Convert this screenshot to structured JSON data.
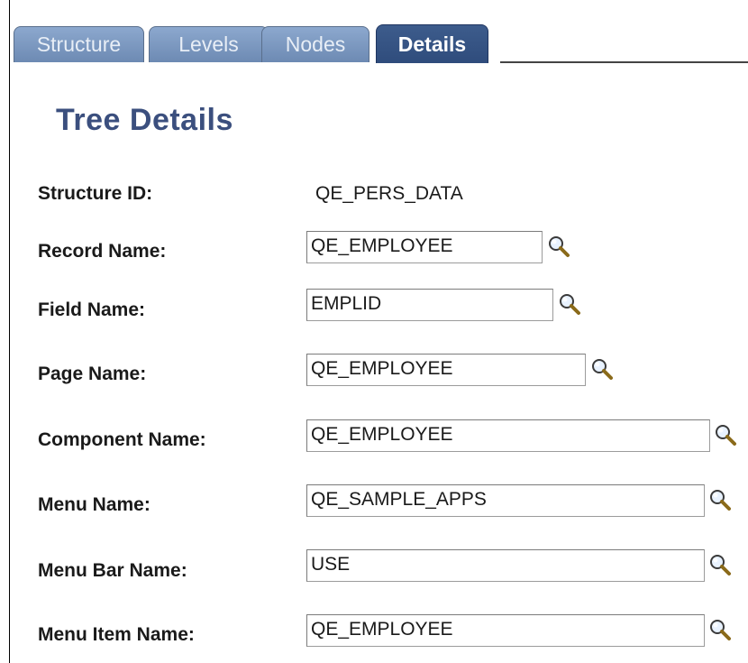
{
  "tabs": [
    {
      "label": "Structure",
      "active": false
    },
    {
      "label": "Levels",
      "active": false
    },
    {
      "label": "Nodes",
      "active": false
    },
    {
      "label": "Details",
      "active": true
    }
  ],
  "page_title": "Tree Details",
  "fields": {
    "structure_id": {
      "label": "Structure ID:",
      "value": "QE_PERS_DATA"
    },
    "record_name": {
      "label": "Record Name:",
      "value": "QE_EMPLOYEE"
    },
    "field_name": {
      "label": "Field Name:",
      "value": "EMPLID"
    },
    "page_name": {
      "label": "Page Name:",
      "value": "QE_EMPLOYEE"
    },
    "component_name": {
      "label": "Component Name:",
      "value": "QE_EMPLOYEE"
    },
    "menu_name": {
      "label": "Menu Name:",
      "value": "QE_SAMPLE_APPS"
    },
    "menu_bar_name": {
      "label": "Menu Bar Name:",
      "value": "USE"
    },
    "menu_item_name": {
      "label": "Menu Item Name:",
      "value": "QE_EMPLOYEE"
    }
  },
  "icons": {
    "lookup": "magnifying-glass-icon"
  },
  "colors": {
    "tab_active": "#2f4c7c",
    "tab_inactive": "#7b97bf",
    "title": "#3b4f7e"
  }
}
